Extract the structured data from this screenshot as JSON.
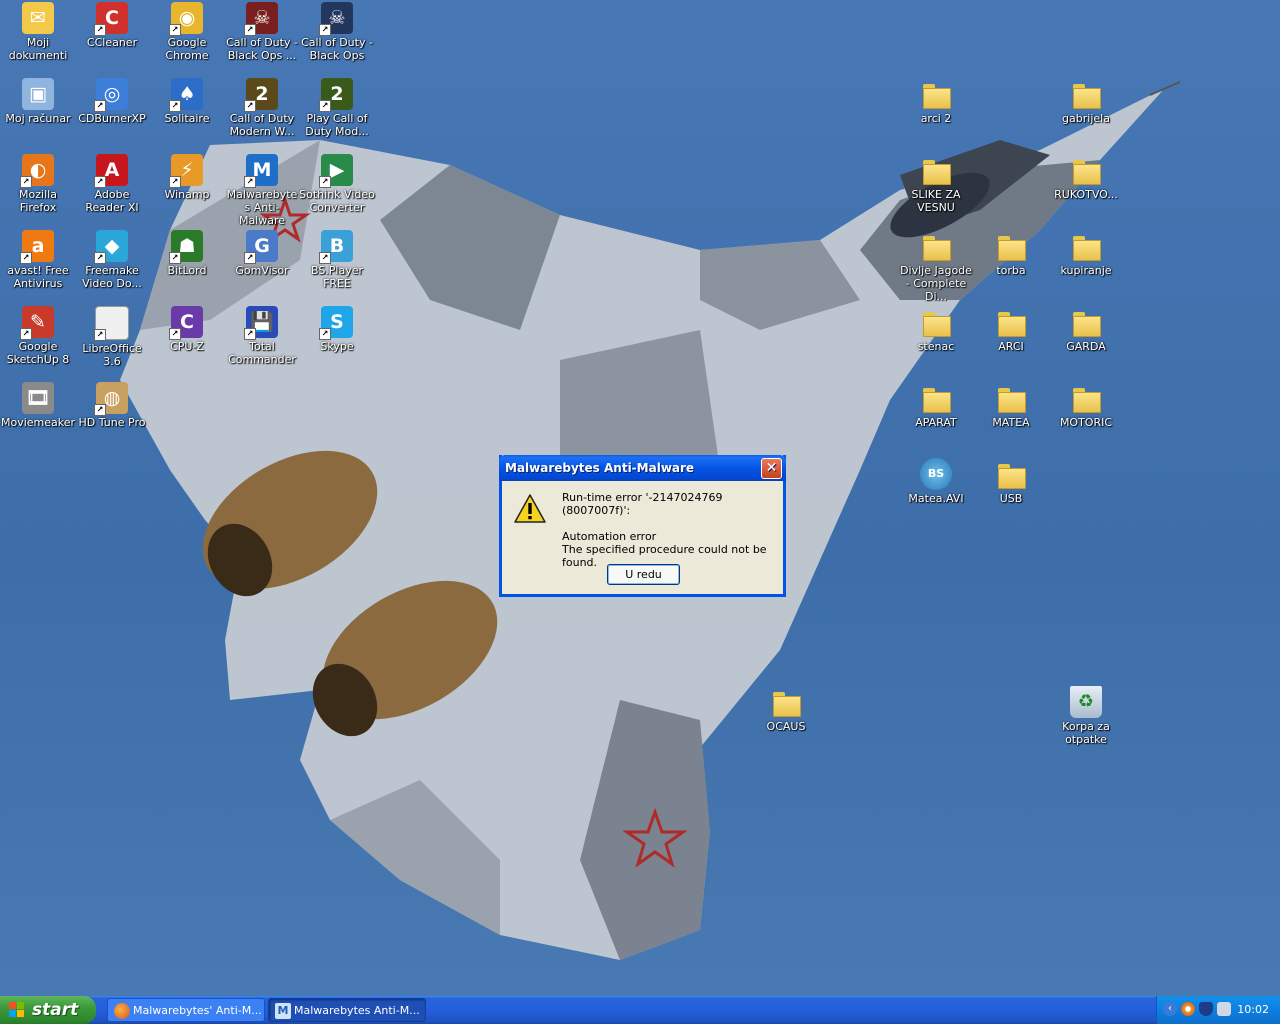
{
  "desktop": {
    "icons": [
      {
        "id": "moji-dokumenti",
        "label": "Moji dokumenti",
        "icon": "my-documents-icon",
        "color": "#f3c94a",
        "glyph": "✉"
      },
      {
        "id": "ccleaner",
        "label": "CCleaner",
        "icon": "ccleaner-icon",
        "color": "#d0312d",
        "glyph": "C"
      },
      {
        "id": "google-chrome",
        "label": "Google Chrome",
        "icon": "chrome-icon",
        "color": "#e8b62c",
        "glyph": "◉"
      },
      {
        "id": "cod-black-ops-1",
        "label": "Call of Duty - Black Ops ...",
        "icon": "call-of-duty-black-ops-icon",
        "color": "#7a1f1f",
        "glyph": "☠"
      },
      {
        "id": "cod-black-ops-2",
        "label": "Call of Duty - Black Ops",
        "icon": "call-of-duty-black-ops-icon",
        "color": "#23365e",
        "glyph": "☠"
      },
      {
        "id": "moj-racunar",
        "label": "Moj računar",
        "icon": "my-computer-icon",
        "color": "#8fb5de",
        "glyph": "▣"
      },
      {
        "id": "cdburnerxp",
        "label": "CDBurnerXP",
        "icon": "cdburnerxp-icon",
        "color": "#3d7ed8",
        "glyph": "◎"
      },
      {
        "id": "solitaire",
        "label": "Solitaire",
        "icon": "solitaire-icon",
        "color": "#2c6dc8",
        "glyph": "♠"
      },
      {
        "id": "cod-mw",
        "label": "Call of Duty Modern W...",
        "icon": "call-of-duty-mw2-icon",
        "color": "#5a4a1a",
        "glyph": "2"
      },
      {
        "id": "play-cod-mw",
        "label": "Play Call of Duty Mod...",
        "icon": "call-of-duty-mw2-icon",
        "color": "#3a5a1a",
        "glyph": "2"
      },
      {
        "id": "mozilla-firefox",
        "label": "Mozilla Firefox",
        "icon": "firefox-icon",
        "color": "#e5761c",
        "glyph": "◐"
      },
      {
        "id": "adobe-reader",
        "label": "Adobe Reader XI",
        "icon": "adobe-reader-icon",
        "color": "#c8161d",
        "glyph": "A"
      },
      {
        "id": "winamp",
        "label": "Winamp",
        "icon": "winamp-icon",
        "color": "#e89a28",
        "glyph": "⚡"
      },
      {
        "id": "malwarebytes",
        "label": "Malwarebytes Anti-Malware",
        "icon": "malwarebytes-icon",
        "color": "#1f6fc8",
        "glyph": "M"
      },
      {
        "id": "sothink",
        "label": "Sothink Video Converter",
        "icon": "sothink-video-converter-icon",
        "color": "#2a8a4a",
        "glyph": "▶"
      },
      {
        "id": "avast",
        "label": "avast! Free Antivirus",
        "icon": "avast-icon",
        "color": "#f07a12",
        "glyph": "a"
      },
      {
        "id": "freemake",
        "label": "Freemake Video Do...",
        "icon": "freemake-icon",
        "color": "#2aa6d8",
        "glyph": "◆"
      },
      {
        "id": "bitlord",
        "label": "BitLord",
        "icon": "bitlord-icon",
        "color": "#2a7a2a",
        "glyph": "☗"
      },
      {
        "id": "gomvisor",
        "label": "GomVisor",
        "icon": "gomvisor-icon",
        "color": "#4a7ac8",
        "glyph": "G"
      },
      {
        "id": "bsplayer",
        "label": "BS.Player FREE",
        "icon": "bsplayer-icon",
        "color": "#3aa0d8",
        "glyph": "B"
      },
      {
        "id": "sketchup",
        "label": "Google SketchUp 8",
        "icon": "sketchup-icon",
        "color": "#c83a2a",
        "glyph": "✎"
      },
      {
        "id": "libreoffice",
        "label": "LibreOffice 3.6",
        "icon": "libreoffice-icon",
        "color": "#f0f0f0",
        "glyph": " "
      },
      {
        "id": "cpu-z",
        "label": "CPU-Z",
        "icon": "cpu-z-icon",
        "color": "#6a3aa8",
        "glyph": "C"
      },
      {
        "id": "total-commander",
        "label": "Total Commander",
        "icon": "total-commander-icon",
        "color": "#2a4ab8",
        "glyph": "💾"
      },
      {
        "id": "skype",
        "label": "Skype",
        "icon": "skype-icon",
        "color": "#1fa6e8",
        "glyph": "S"
      },
      {
        "id": "moviemeaker",
        "label": "Moviemeaker",
        "icon": "movie-maker-icon",
        "color": "#8a8a8a",
        "glyph": "🎞"
      },
      {
        "id": "hd-tune",
        "label": "HD Tune Pro",
        "icon": "hd-tune-icon",
        "color": "#c8a060",
        "glyph": "◍"
      }
    ],
    "folders": [
      {
        "id": "arci2",
        "label": "arci 2"
      },
      {
        "id": "gabrijela",
        "label": "gabrijela"
      },
      {
        "id": "slike-za-vesnu",
        "label": "SLIKE ZA VESNU"
      },
      {
        "id": "rukotvo",
        "label": "RUKOTVO..."
      },
      {
        "id": "divlje-jagode",
        "label": "Divlje Jagode - Complete Di..."
      },
      {
        "id": "torba",
        "label": "torba"
      },
      {
        "id": "kupiranje",
        "label": "kupiranje"
      },
      {
        "id": "stenac",
        "label": "stenac"
      },
      {
        "id": "arci",
        "label": "ARCI"
      },
      {
        "id": "garda",
        "label": "GARDA"
      },
      {
        "id": "aparat",
        "label": "APARAT"
      },
      {
        "id": "matea",
        "label": "MATEA"
      },
      {
        "id": "motoric",
        "label": "MOTORIC"
      },
      {
        "id": "usb",
        "label": "USB"
      },
      {
        "id": "ocaus",
        "label": "OCAUS"
      }
    ],
    "matea_avi": {
      "label": "Matea.AVI",
      "icon": "bsplayer-file-icon"
    },
    "recycle_bin": {
      "label": "Korpa za otpatke",
      "icon": "recycle-bin-icon"
    }
  },
  "dialog": {
    "title": "Malwarebytes Anti-Malware",
    "line1": "Run-time error '-2147024769 (8007007f)':",
    "line2": "Automation error",
    "line3": "The specified procedure could not be found.",
    "ok_label": "U redu",
    "close_glyph": "✕",
    "icon": "warning-icon"
  },
  "taskbar": {
    "start_label": "start",
    "tasks": [
      {
        "label": "Malwarebytes' Anti-M...",
        "icon": "firefox-icon"
      },
      {
        "label": "Malwarebytes Anti-M...",
        "icon": "malwarebytes-icon"
      }
    ],
    "clock": "10:02",
    "tray_icons": [
      "show-hidden-icons-icon",
      "chrome-tray-icon",
      "security-shield-icon",
      "network-icon"
    ]
  },
  "colors": {
    "desktop_bg": "#4777b5",
    "taskbar": "#245edb",
    "start": "#3c9a3a",
    "titlebar": "#0454e3",
    "dialog_face": "#ece9d8",
    "folder": "#f3d060"
  }
}
